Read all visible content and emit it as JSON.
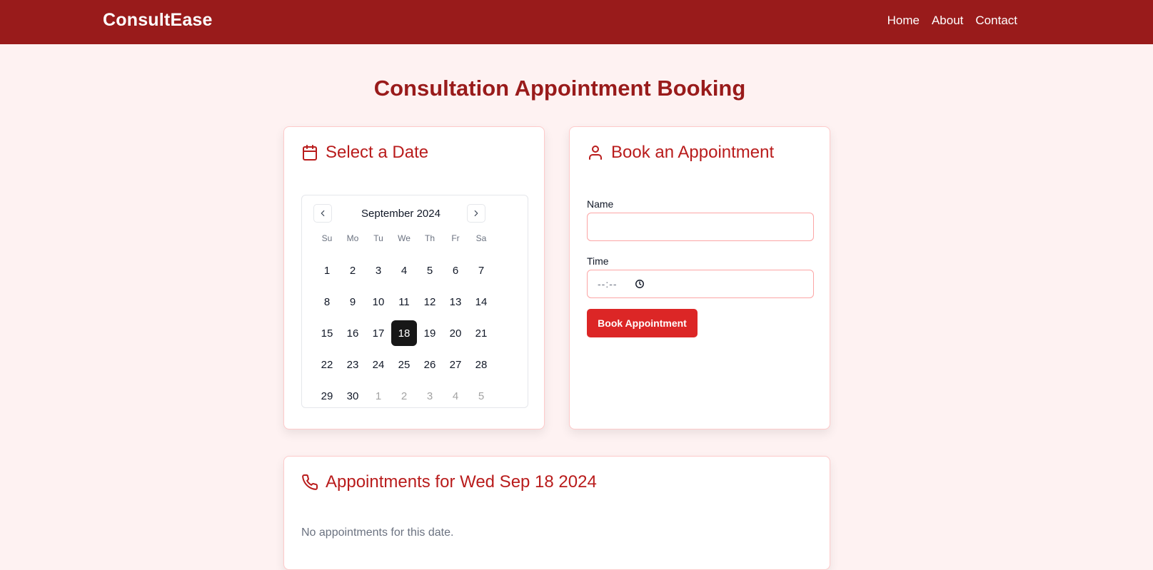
{
  "header": {
    "brand": "ConsultEase",
    "nav": [
      "Home",
      "About",
      "Contact"
    ]
  },
  "page_title": "Consultation Appointment Booking",
  "date_card": {
    "title": "Select a Date",
    "calendar": {
      "month_label": "September 2024",
      "weekdays": [
        "Su",
        "Mo",
        "Tu",
        "We",
        "Th",
        "Fr",
        "Sa"
      ],
      "weeks": [
        [
          "1",
          "2",
          "3",
          "4",
          "5",
          "6",
          "7"
        ],
        [
          "8",
          "9",
          "10",
          "11",
          "12",
          "13",
          "14"
        ],
        [
          "15",
          "16",
          "17",
          "18",
          "19",
          "20",
          "21"
        ],
        [
          "22",
          "23",
          "24",
          "25",
          "26",
          "27",
          "28"
        ],
        [
          "29",
          "30",
          "1",
          "2",
          "3",
          "4",
          "5"
        ]
      ],
      "selected_day": "18",
      "outside_month_cells": [
        [
          4,
          2
        ],
        [
          4,
          3
        ],
        [
          4,
          4
        ],
        [
          4,
          5
        ],
        [
          4,
          6
        ]
      ]
    }
  },
  "booking_card": {
    "title": "Book an Appointment",
    "name_label": "Name",
    "name_value": "",
    "time_label": "Time",
    "time_placeholder": "--:--",
    "submit_label": "Book Appointment"
  },
  "appointments_card": {
    "title": "Appointments for Wed Sep 18 2024",
    "empty_message": "No appointments for this date."
  },
  "icons": {
    "date_card": "calendar-icon",
    "booking_card": "user-icon",
    "appointments_card": "phone-icon",
    "time_field": "clock-icon"
  },
  "colors": {
    "header_bg": "#991b1b",
    "page_bg": "#fef2f2",
    "accent": "#b91c1c",
    "button": "#dc2626",
    "selected_day": "#171717"
  }
}
